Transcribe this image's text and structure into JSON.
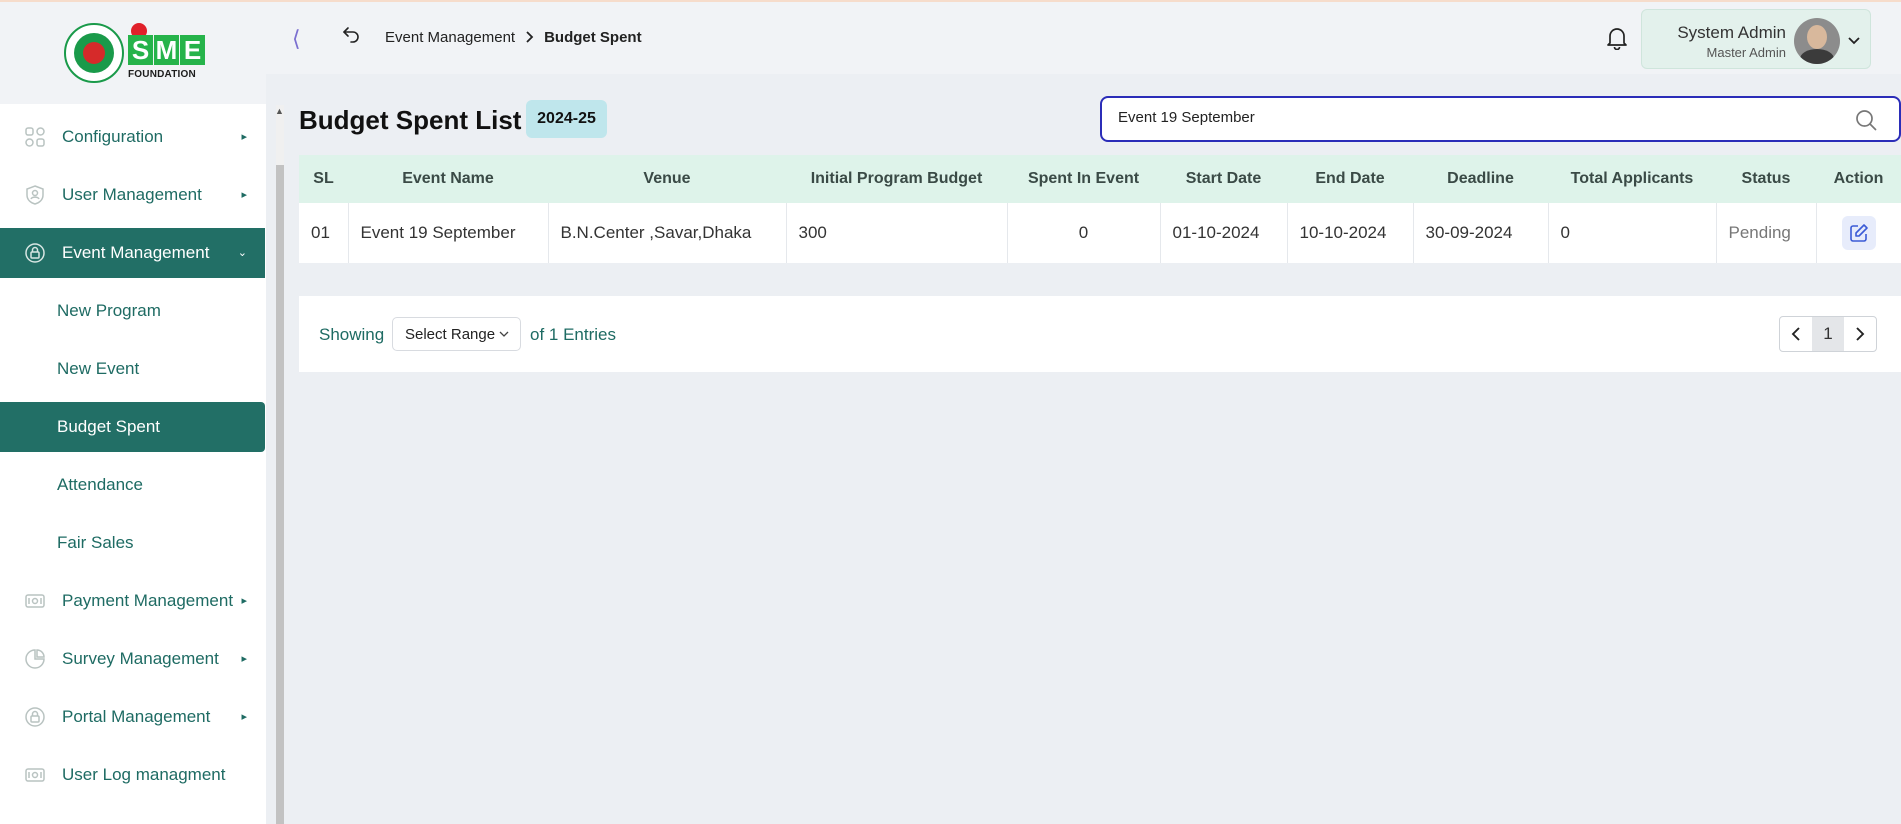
{
  "brand": {
    "logo_letters": [
      "S",
      "M",
      "E"
    ],
    "logo_subtitle": "FOUNDATION"
  },
  "sidebar": {
    "items": [
      {
        "label": "Configuration",
        "icon": "cube-network-icon",
        "expanded": false
      },
      {
        "label": "User Management",
        "icon": "user-shield-icon",
        "expanded": false
      },
      {
        "label": "Event Management",
        "icon": "lock-circle-icon",
        "expanded": true,
        "active": true
      },
      {
        "label": "Payment Management",
        "icon": "money-icon",
        "expanded": false
      },
      {
        "label": "Survey Management",
        "icon": "pie-chart-icon",
        "expanded": false
      },
      {
        "label": "Portal Management",
        "icon": "lock-circle-icon",
        "expanded": false
      },
      {
        "label": "User Log managment",
        "icon": "money-icon"
      }
    ],
    "sub_items": [
      "New Program",
      "New Event",
      "Budget Spent",
      "Attendance",
      "Fair Sales"
    ],
    "active_sub": "Budget Spent"
  },
  "header": {
    "breadcrumb": {
      "parent": "Event Management",
      "current": "Budget Spent"
    },
    "user": {
      "name": "System Admin",
      "role": "Master Admin"
    }
  },
  "main": {
    "title": "Budget Spent List",
    "fiscal_year": "2024-25",
    "search": {
      "value": "Event 19 September",
      "placeholder": ""
    },
    "table": {
      "columns": [
        "SL",
        "Event Name",
        "Venue",
        "Initial Program Budget",
        "Spent In Event",
        "Start Date",
        "End Date",
        "Deadline",
        "Total Applicants",
        "Status",
        "Action"
      ],
      "rows": [
        {
          "sl": "01",
          "event_name": "Event 19 September",
          "venue": "B.N.Center ,Savar,Dhaka",
          "initial_budget": "300",
          "spent": "0",
          "start_date": "01-10-2024",
          "end_date": "10-10-2024",
          "deadline": "30-09-2024",
          "total_applicants": "0",
          "status": "Pending"
        }
      ]
    },
    "pagination": {
      "showing_label": "Showing",
      "range_label": "Select Range",
      "entries_label": "of 1 Entries",
      "current_page": "1"
    }
  },
  "colors": {
    "primary": "#226f66",
    "accent_border": "#2b2db8",
    "header_row": "#def3ea",
    "badge": "#bfe6ec"
  }
}
